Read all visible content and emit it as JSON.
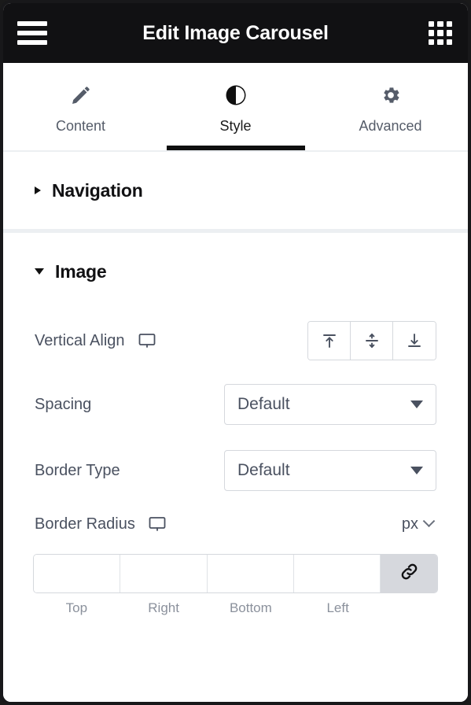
{
  "header": {
    "title": "Edit Image Carousel",
    "menu_icon": "hamburger-icon",
    "apps_icon": "grid-icon"
  },
  "tabs": [
    {
      "label": "Content",
      "icon": "pencil-icon",
      "active": false
    },
    {
      "label": "Style",
      "icon": "contrast-icon",
      "active": true
    },
    {
      "label": "Advanced",
      "icon": "gear-icon",
      "active": false
    }
  ],
  "sections": [
    {
      "title": "Navigation",
      "expanded": false,
      "caret": "caret-right-icon"
    },
    {
      "title": "Image",
      "expanded": true,
      "caret": "caret-down-icon"
    }
  ],
  "controls": {
    "vertical_align": {
      "label": "Vertical Align",
      "device_icon": "desktop-icon",
      "options": [
        {
          "name": "align-top",
          "icon": "align-top-icon",
          "selected": false
        },
        {
          "name": "align-middle",
          "icon": "align-middle-icon",
          "selected": false
        },
        {
          "name": "align-bottom",
          "icon": "align-bottom-icon",
          "selected": false
        }
      ]
    },
    "spacing": {
      "label": "Spacing",
      "value": "Default",
      "arrow_icon": "chevron-down-icon"
    },
    "border_type": {
      "label": "Border Type",
      "value": "Default",
      "arrow_icon": "chevron-down-icon"
    },
    "border_radius": {
      "label": "Border Radius",
      "device_icon": "desktop-icon",
      "unit": "px",
      "unit_arrow_icon": "chevron-down-icon",
      "link_icon": "link-icon",
      "fields": [
        {
          "label": "Top",
          "value": "",
          "placeholder": ""
        },
        {
          "label": "Right",
          "value": "",
          "placeholder": ""
        },
        {
          "label": "Bottom",
          "value": "",
          "placeholder": ""
        },
        {
          "label": "Left",
          "value": "",
          "placeholder": ""
        }
      ]
    }
  },
  "colors": {
    "header_bg": "#111113",
    "panel_border": "#18181a",
    "accent": "#0f0f0f",
    "label_text": "#4a5160",
    "muted_text": "#8b919c",
    "field_border": "#d5d8dd",
    "divider": "#eceff2",
    "link_btn_bg": "#d6d8dd"
  }
}
